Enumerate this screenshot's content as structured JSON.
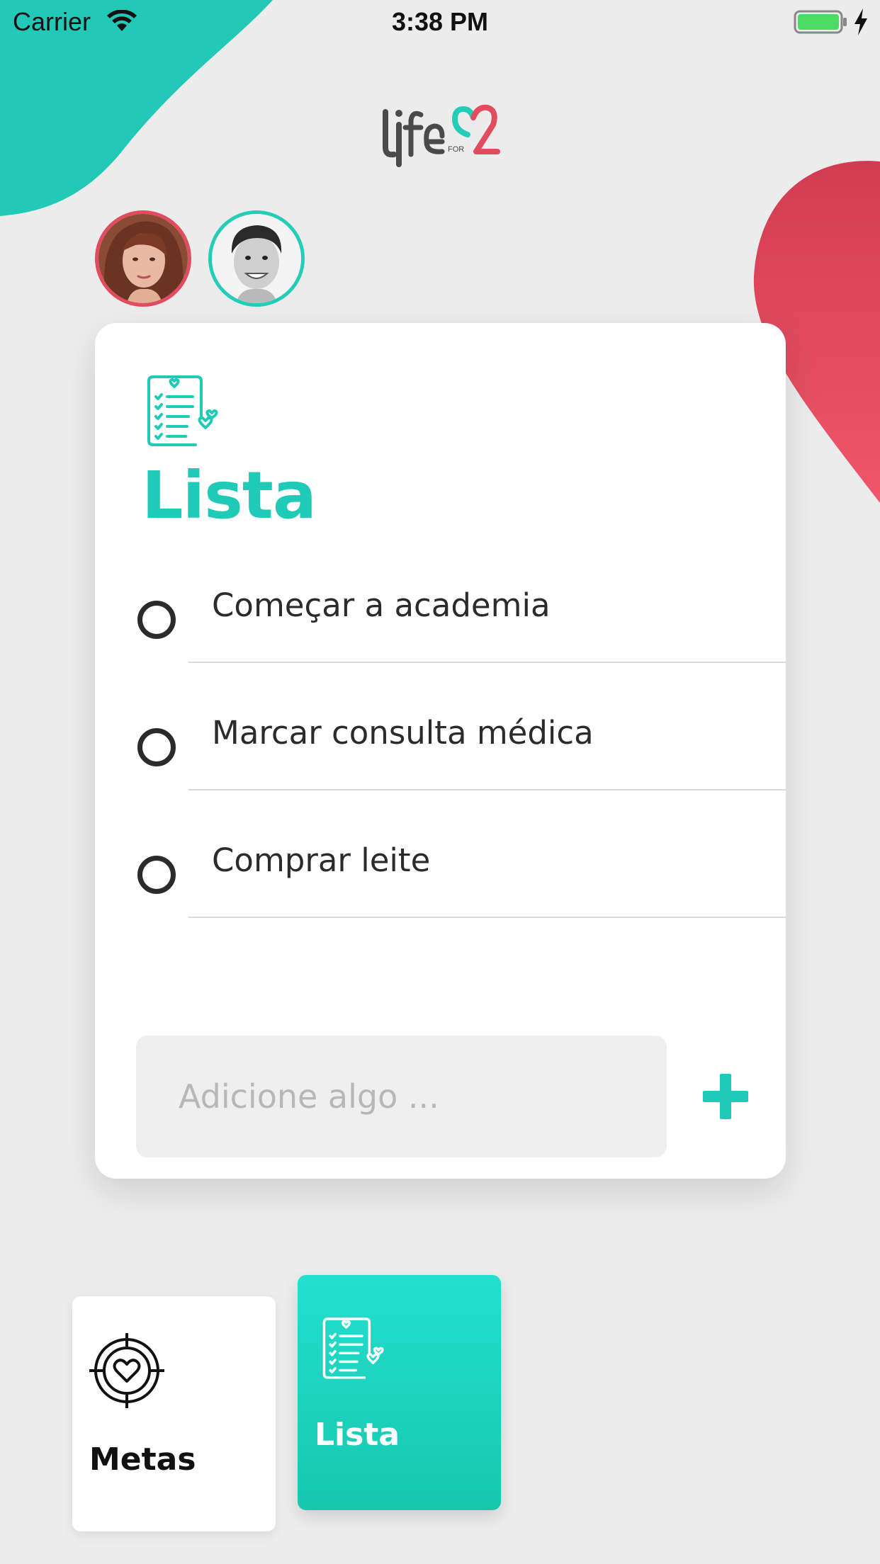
{
  "status_bar": {
    "carrier": "Carrier",
    "time": "3:38 PM"
  },
  "colors": {
    "accent": "#1fcab6",
    "heart": "#e14c5f",
    "background": "#ececec"
  },
  "header": {
    "logo_text": "life FOR 2"
  },
  "couple": {
    "avatars": [
      "female-avatar",
      "male-avatar"
    ]
  },
  "list_card": {
    "icon": "checklist-icon",
    "title": "Lista",
    "items": [
      {
        "label": "Começar a academia",
        "checked": false
      },
      {
        "label": "Marcar consulta médica",
        "checked": false
      },
      {
        "label": "Comprar leite",
        "checked": false
      }
    ],
    "add_input": {
      "placeholder": "Adicione algo ...",
      "value": ""
    },
    "add_button_icon": "plus-icon"
  },
  "tabs": [
    {
      "label": "Metas",
      "icon": "target-heart-icon",
      "active": false
    },
    {
      "label": "Lista",
      "icon": "checklist-icon",
      "active": true
    }
  ]
}
